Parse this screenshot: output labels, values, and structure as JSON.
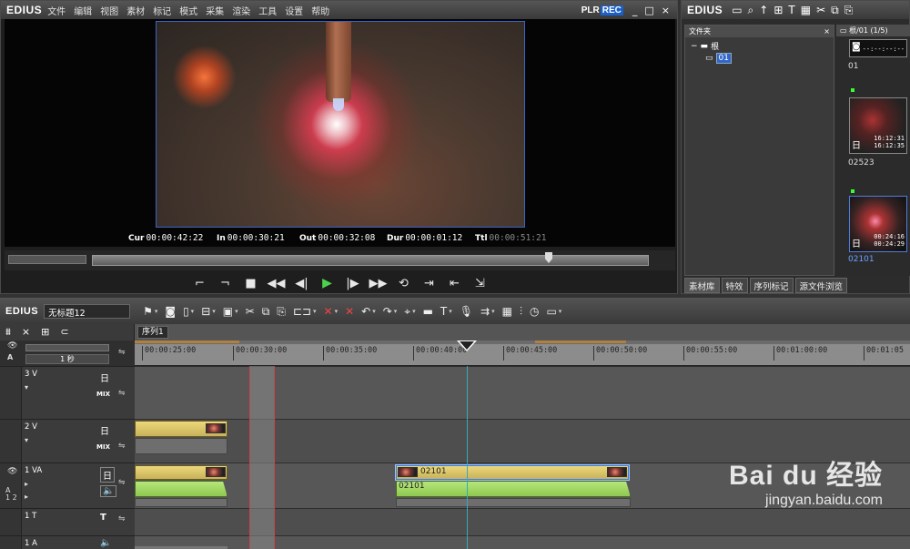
{
  "app": {
    "logo": "EDIUS"
  },
  "menu": [
    "文件",
    "编辑",
    "视图",
    "素材",
    "标记",
    "模式",
    "采集",
    "渲染",
    "工具",
    "设置",
    "帮助"
  ],
  "player": {
    "mode_plr": "PLR",
    "mode_rec": "REC",
    "window_buttons": [
      "_",
      "□",
      "×"
    ],
    "timecodes": {
      "cur": {
        "label": "Cur",
        "value": "00:00:42:22"
      },
      "in": {
        "label": "In",
        "value": "00:00:30:21"
      },
      "out": {
        "label": "Out",
        "value": "00:00:32:08"
      },
      "dur": {
        "label": "Dur",
        "value": "00:00:01:12"
      },
      "ttl": {
        "label": "Ttl",
        "value": "00:00:51:21"
      }
    }
  },
  "bin": {
    "logo": "EDIUS",
    "folder_header": "文件夹",
    "clips_header": "根/01 (1/5)",
    "tree": [
      {
        "label": "根",
        "expander": "−"
      },
      {
        "label": "01"
      }
    ],
    "clips": [
      {
        "name": "01",
        "time": "--:--:--:--"
      },
      {
        "name": "02523",
        "time_in": "16:12:31",
        "time_out": "16:12:35"
      },
      {
        "name": "02101",
        "time_in": "00:24:16",
        "time_out": "00:24:29",
        "selected": true
      }
    ],
    "tabs": [
      "素材库",
      "特效",
      "序列标记",
      "源文件浏览"
    ]
  },
  "timeline": {
    "logo": "EDIUS",
    "sequence_name": "无标题12",
    "sequence_tab": "序列1",
    "scale": "1 秒",
    "ticks": [
      {
        "label": "00:00:25:00"
      },
      {
        "label": "00:00:30:00"
      },
      {
        "label": "00:00:35:00"
      },
      {
        "label": "00:00:40:00"
      },
      {
        "label": "00:00:45:00"
      },
      {
        "label": "00:00:50:00"
      },
      {
        "label": "00:00:55:00"
      },
      {
        "label": "00:01:00:00"
      },
      {
        "label": "00:01:05"
      }
    ],
    "tracks": [
      {
        "name": "3 V",
        "mix": "MIX"
      },
      {
        "name": "2 V",
        "mix": "MIX"
      },
      {
        "name": "1 VA",
        "row_label_a": "A",
        "row_label_12": "1 2"
      },
      {
        "name": "1 T"
      },
      {
        "name": "1 A"
      }
    ],
    "clip_on_1va": {
      "video_name": "02101",
      "audio_name": "02101"
    }
  },
  "watermark": {
    "main": "Bai du 经验",
    "sub": "jingyan.baidu.com"
  },
  "colors": {
    "rec": "#1b5fc9",
    "play": "#4cd24c",
    "video_clip": "#ecd87a",
    "audio_clip": "#b6e67a",
    "cursor": "#33aabb",
    "in_out": "#cc4444"
  }
}
